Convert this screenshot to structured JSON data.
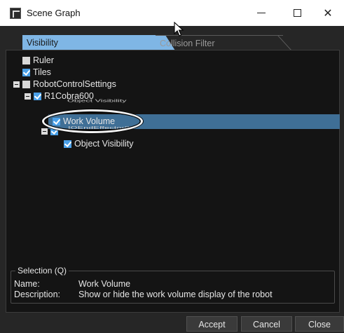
{
  "window": {
    "title": "Scene Graph",
    "minimize_label": "—",
    "close_label": "✕"
  },
  "tabs": [
    {
      "label": "Visibility",
      "active": true
    },
    {
      "label": "Collision Filter",
      "active": false
    }
  ],
  "tree": [
    {
      "label": "Ruler",
      "checked": false
    },
    {
      "label": "Tiles",
      "checked": true
    },
    {
      "label": "RobotControlSettings",
      "checked": false,
      "expanded": true
    },
    {
      "label": "R1Cobra600",
      "checked": true,
      "expanded": true
    },
    {
      "label": "Work Volume",
      "checked": true,
      "selected": true
    },
    {
      "label": "Object Visibility",
      "checked": true
    }
  ],
  "selection": {
    "legend": "Selection (Q)",
    "name_label": "Name:",
    "name_value": "Work Volume",
    "desc_label": "Description:",
    "desc_value": "Show or hide the work volume display of the robot"
  },
  "buttons": {
    "accept": "Accept",
    "cancel": "Cancel",
    "close": "Close"
  },
  "colors": {
    "accent": "#7fb6e5",
    "checkbox": "#4aa0e8",
    "selection": "#3f6f96"
  }
}
